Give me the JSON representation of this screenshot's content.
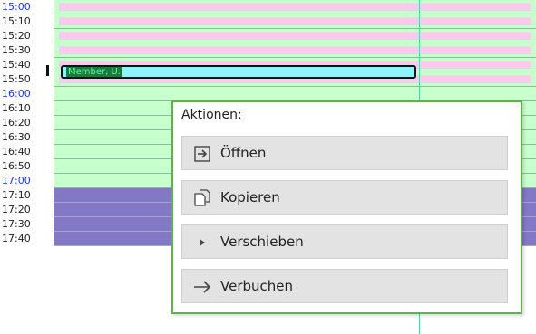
{
  "schedule": {
    "rows": [
      {
        "time": "15:00",
        "hour": true,
        "fill": "#c8ffcc",
        "band": "#ffc8f2"
      },
      {
        "time": "15:10",
        "hour": false,
        "fill": "#c8ffcc",
        "band": "#ffc8f2"
      },
      {
        "time": "15:20",
        "hour": false,
        "fill": "#c8ffcc",
        "band": "#ffc8f2"
      },
      {
        "time": "15:30",
        "hour": false,
        "fill": "#c8ffcc",
        "band": "#ffc8f2"
      },
      {
        "time": "15:40",
        "hour": false,
        "fill": "#c8ffcc",
        "band": "#ffc8f2"
      },
      {
        "time": "15:50",
        "hour": false,
        "fill": "#c8ffcc",
        "band": "#ffc8f2"
      },
      {
        "time": "16:00",
        "hour": true,
        "fill": "#c8ffcc",
        "band": ""
      },
      {
        "time": "16:10",
        "hour": false,
        "fill": "#c8ffcc",
        "band": ""
      },
      {
        "time": "16:20",
        "hour": false,
        "fill": "#c8ffcc",
        "band": ""
      },
      {
        "time": "16:30",
        "hour": false,
        "fill": "#c8ffcc",
        "band": ""
      },
      {
        "time": "16:40",
        "hour": false,
        "fill": "#c8ffcc",
        "band": ""
      },
      {
        "time": "16:50",
        "hour": false,
        "fill": "#c8ffcc",
        "band": ""
      },
      {
        "time": "17:00",
        "hour": true,
        "fill": "#c8ffcc",
        "band": ""
      },
      {
        "time": "17:10",
        "hour": false,
        "fill": "#8478c4",
        "band": ""
      },
      {
        "time": "17:20",
        "hour": false,
        "fill": "#8478c4",
        "band": ""
      },
      {
        "time": "17:30",
        "hour": false,
        "fill": "#8478c4",
        "band": ""
      },
      {
        "time": "17:40",
        "hour": false,
        "fill": "#8478c4",
        "band": ""
      }
    ],
    "appointment": {
      "label": "Member, U."
    }
  },
  "menu": {
    "title": "Aktionen:",
    "items": [
      {
        "label": "Öffnen",
        "icon": "open-arrow-icon"
      },
      {
        "label": "Kopieren",
        "icon": "copy-icon"
      },
      {
        "label": "Verschieben",
        "icon": "triangle-right-icon"
      },
      {
        "label": "Verbuchen",
        "icon": "arrow-right-icon"
      }
    ]
  },
  "colors": {
    "hour_label": "#1c3bd6",
    "grid_line": "#4fd6b0",
    "menu_border": "#5fb24a"
  }
}
